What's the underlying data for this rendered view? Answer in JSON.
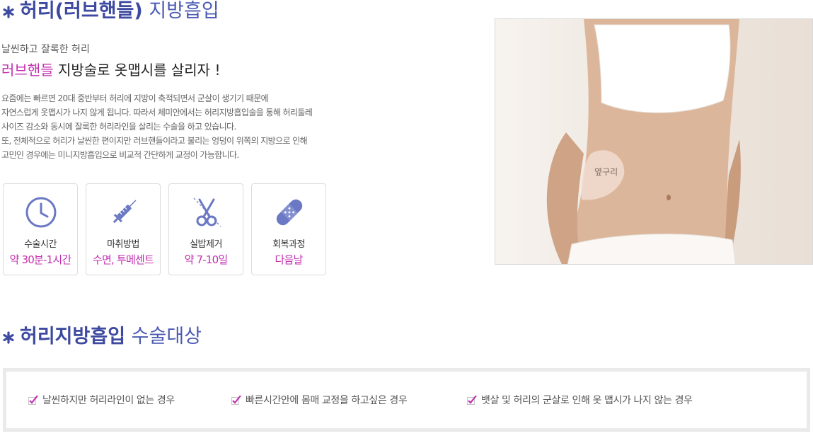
{
  "section1": {
    "title_bold": "허리(러브핸들)",
    "title_light": "지방흡입",
    "subtitle": "날씬하고 잘록한 허리",
    "headline_accent": "러브핸들",
    "headline_rest": "지방술로 옷맵시를 살리자 !",
    "paragraph": [
      "요즘에는 빠르면 20대 중반부터 허리에 지방이 축적되면서 군살이 생기기 때문에",
      "자연스럽게 옷맵시가 나지 않게 됩니다. 따라서 체미안에서는 허리지방흡입술을 통해 허리둘레",
      "사이즈 감소와 동시에 잘록한 허리라인을 살리는 수술을 하고 있습니다.",
      "또, 전체적으로 허리가 날씬한 편이지만 러브핸들이라고 불리는 엉덩이 위쪽의 지방으로 인해",
      "고민인 경우에는 미니지방흡입으로 비교적 간단하게 교정이 가능합니다."
    ],
    "cards": [
      {
        "icon": "clock-icon",
        "label": "수술시간",
        "value": "약 30분-1시간"
      },
      {
        "icon": "syringe-icon",
        "label": "마취방법",
        "value": "수면, 투메센트"
      },
      {
        "icon": "scissors-icon",
        "label": "실밥제거",
        "value": "약 7-10일"
      },
      {
        "icon": "bandage-icon",
        "label": "회복과정",
        "value": "다음날"
      }
    ],
    "photo_label": "옆구리"
  },
  "section2": {
    "title_bold": "허리지방흡입",
    "title_light": "수술대상",
    "targets": [
      "날씬하지만 허리라인이 없는 경우",
      "빠른시간안에 몸매 교정을 하고싶은 경우",
      "뱃살 및 허리의 군살로 인해 옷 맵시가 나지 않는 경우"
    ]
  },
  "colors": {
    "accent": "#c22fb0",
    "title": "#3d4aa0",
    "icon": "#6b78c4"
  }
}
